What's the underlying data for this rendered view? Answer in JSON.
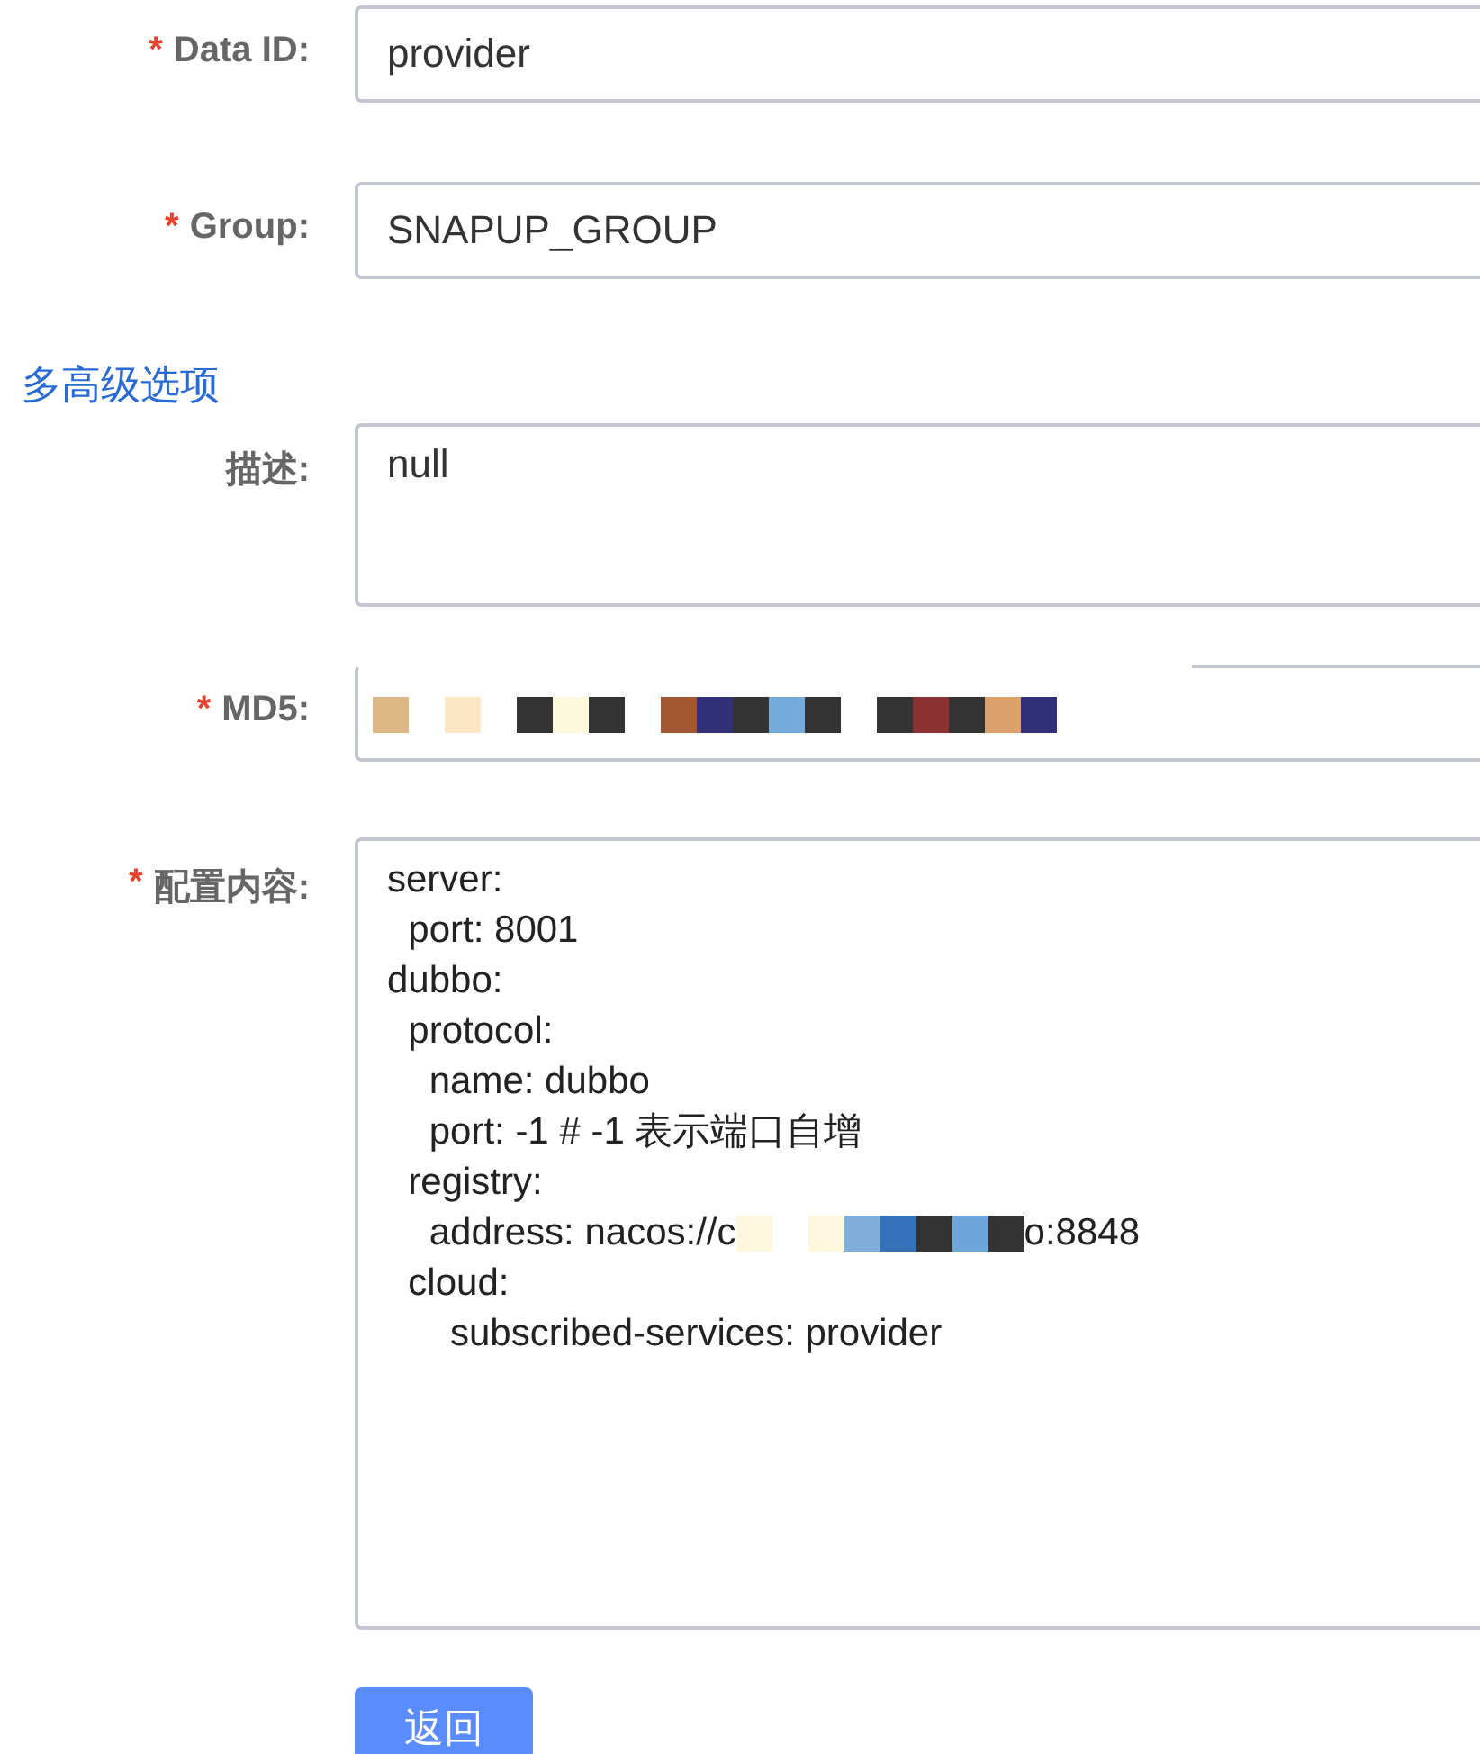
{
  "required_mark": "*",
  "fields": [
    {
      "kind": "input",
      "label": "Data ID:",
      "required": true,
      "value": "provider"
    },
    {
      "kind": "input",
      "label": "Group:",
      "required": true,
      "value": "SNAPUP_GROUP"
    },
    {
      "kind": "link",
      "label": "多高级选项"
    },
    {
      "kind": "textarea",
      "label": "描述:",
      "required": false,
      "value": "null"
    },
    {
      "kind": "redacted",
      "label": "MD5:",
      "required": true
    },
    {
      "kind": "code",
      "label": "配置内容:",
      "required": true,
      "lines": [
        [
          {
            "kind": "text",
            "text": "server:"
          }
        ],
        [
          {
            "kind": "text",
            "text": "  port: 8001"
          }
        ],
        [
          {
            "kind": "text",
            "text": "dubbo:"
          }
        ],
        [
          {
            "kind": "text",
            "text": "  protocol:"
          }
        ],
        [
          {
            "kind": "text",
            "text": "    name: dubbo"
          }
        ],
        [
          {
            "kind": "text",
            "text": "    port: -1 # -1 表示端口自增"
          }
        ],
        [
          {
            "kind": "text",
            "text": "  registry:"
          }
        ],
        [
          {
            "kind": "text",
            "text": "    address: nacos://c"
          },
          {
            "kind": "redacted"
          },
          {
            "kind": "text",
            "text": "o:8848"
          }
        ],
        [
          {
            "kind": "text",
            "text": "  cloud:"
          }
        ],
        [
          {
            "kind": "text",
            "text": "      subscribed-services: provider"
          }
        ]
      ]
    }
  ],
  "buttons": [
    {
      "label": "返回"
    }
  ]
}
